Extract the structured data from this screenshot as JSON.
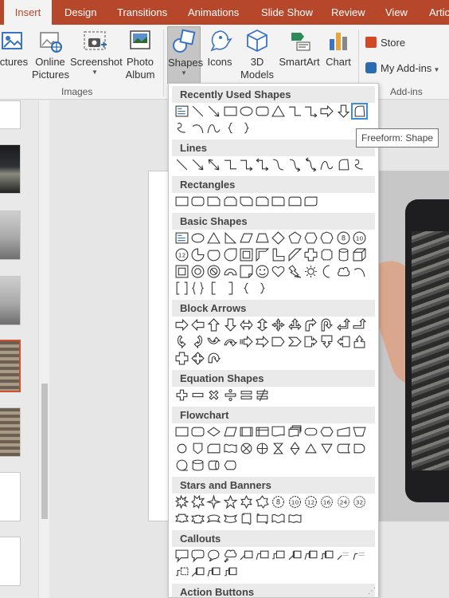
{
  "tabs": [
    {
      "label": "Insert",
      "active": true
    },
    {
      "label": "Design"
    },
    {
      "label": "Transitions"
    },
    {
      "label": "Animations"
    },
    {
      "label": "Slide Show"
    },
    {
      "label": "Review"
    },
    {
      "label": "View"
    },
    {
      "label": "Artic"
    }
  ],
  "ribbon": {
    "images_group_label": "Images",
    "addins_group_label": "Add-ins",
    "pictures": "ictures",
    "online_pictures_1": "Online",
    "online_pictures_2": "Pictures",
    "screenshot": "Screenshot",
    "photo_album_1": "Photo",
    "photo_album_2": "Album",
    "shapes": "Shapes",
    "icons": "Icons",
    "models_1": "3D",
    "models_2": "Models",
    "smartart": "SmartArt",
    "chart": "Chart",
    "store": "Store",
    "my_addins": "My Add-ins",
    "colors": {
      "tab_bar": "#b7472a",
      "store_icon": "#d24726",
      "addins_icon": "#2b6cb0"
    }
  },
  "gallery": {
    "categories": {
      "recent": "Recently Used Shapes",
      "lines": "Lines",
      "rectangles": "Rectangles",
      "basic": "Basic Shapes",
      "block_arrows": "Block Arrows",
      "equation": "Equation Shapes",
      "flowchart": "Flowchart",
      "stars": "Stars and Banners",
      "callouts": "Callouts",
      "action": "Action Buttons"
    },
    "highlighted_shape": "Freeform: Shape"
  },
  "tooltip": {
    "text": "Freeform: Shape"
  },
  "accent_color": "#3c8fd7"
}
